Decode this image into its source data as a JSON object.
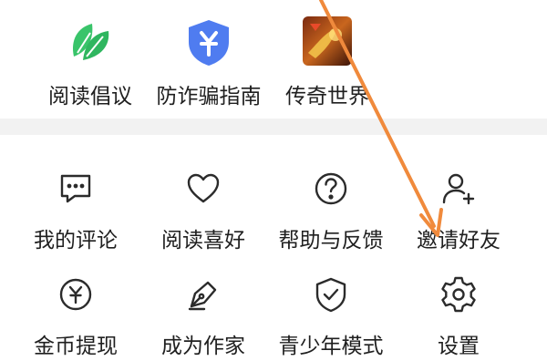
{
  "top_items": [
    {
      "label": "阅读倡议",
      "icon": "leaf-icon"
    },
    {
      "label": "防诈骗指南",
      "icon": "shield-yuan-icon"
    },
    {
      "label": "传奇世界",
      "icon": "game-thumbnail-icon"
    }
  ],
  "grid_items": [
    {
      "label": "我的评论",
      "icon": "comment-icon"
    },
    {
      "label": "阅读喜好",
      "icon": "heart-icon"
    },
    {
      "label": "帮助与反馈",
      "icon": "help-icon"
    },
    {
      "label": "邀请好友",
      "icon": "add-user-icon"
    },
    {
      "label": "金币提现",
      "icon": "coin-icon"
    },
    {
      "label": "成为作家",
      "icon": "pen-nib-icon"
    },
    {
      "label": "青少年模式",
      "icon": "shield-check-icon"
    },
    {
      "label": "设置",
      "icon": "gear-icon"
    }
  ],
  "colors": {
    "leaf": "#39c46a",
    "shield_blue": "#4f7cf0",
    "annotation_arrow": "#f08a3c",
    "icon_stroke": "#2b2b2b"
  }
}
